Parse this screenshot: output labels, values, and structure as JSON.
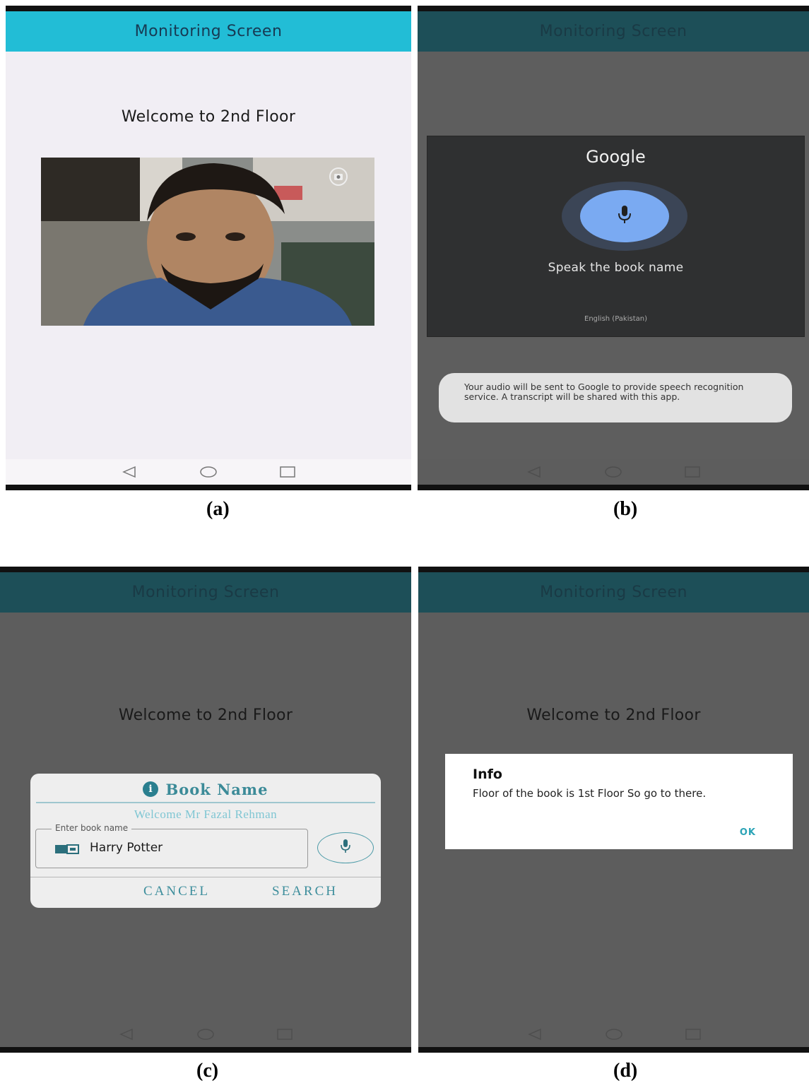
{
  "panels": {
    "a": {
      "app_title": "Monitoring Screen",
      "welcome": "Welcome to 2nd Floor",
      "caption": "(a)"
    },
    "b": {
      "app_title": "Monitoring Screen",
      "google_title": "Google",
      "prompt": "Speak the book name",
      "language": "English (Pakistan)",
      "notice": "Your audio will be sent to Google to provide speech recognition service. A transcript will be shared with this app.",
      "caption": "(b)"
    },
    "c": {
      "app_title": "Monitoring Screen",
      "welcome": "Welcome to 2nd Floor",
      "dialog_title": "Book Name",
      "dialog_welcome": "Welcome Mr Fazal Rehman",
      "field_label": "Enter book name",
      "field_value": "Harry Potter",
      "cancel_label": "CANCEL",
      "search_label": "SEARCH",
      "caption": "(c)"
    },
    "d": {
      "app_title": "Monitoring Screen",
      "welcome": "Welcome to 2nd Floor",
      "dialog_title": "Info",
      "dialog_message": "Floor of the book is 1st Floor So go to there.",
      "ok_label": "OK",
      "caption": "(d)"
    }
  },
  "icons": {
    "nav": [
      "back-triangle-icon",
      "home-circle-icon",
      "recents-square-icon"
    ],
    "mic": "microphone-icon",
    "camera_switch": "camera-switch-icon",
    "info": "info-icon",
    "book": "book-icon"
  },
  "colors": {
    "appbar": "#22bdd6",
    "appbar_dimmed": "#1d4f58",
    "scrim": "#5d5d5d",
    "accent": "#3d8e9c",
    "google_mic": "#7aaaf2"
  }
}
